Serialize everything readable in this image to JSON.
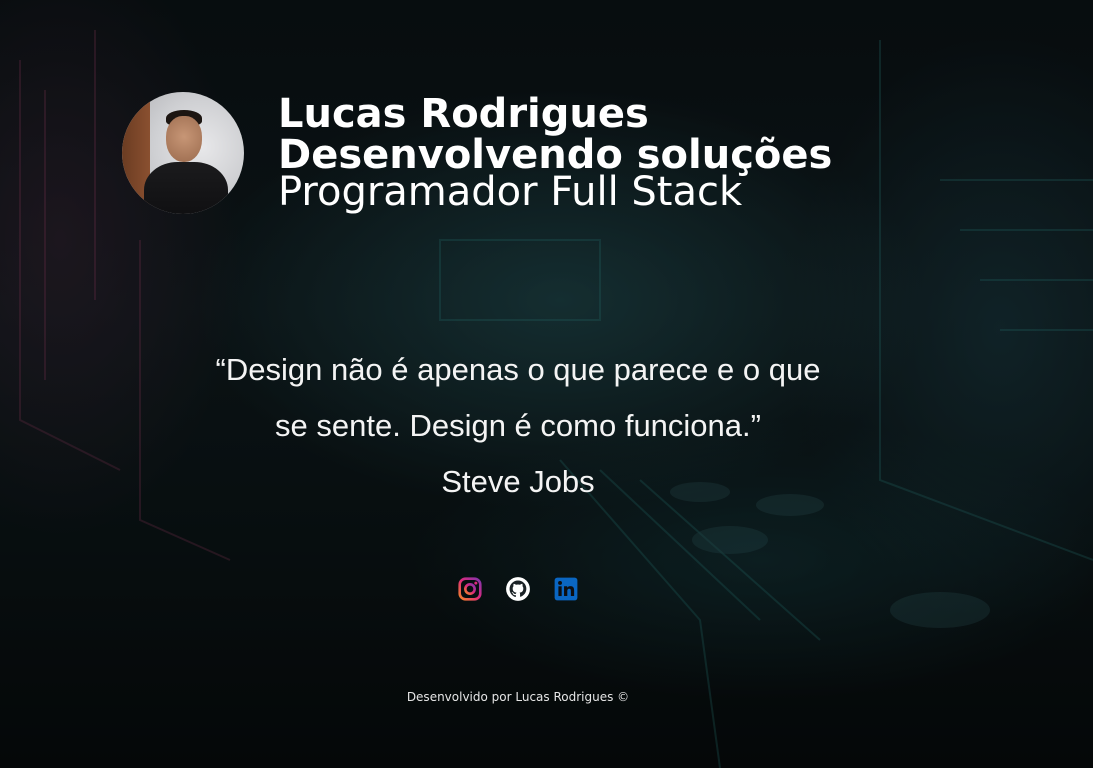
{
  "header": {
    "name": "Lucas Rodrigues",
    "tagline": "Desenvolvendo soluções",
    "role": "Programador Full Stack"
  },
  "quote": {
    "line1": "“Design não é apenas o que parece e o que",
    "line2": "se sente. Design é como funciona.”",
    "author": "Steve Jobs"
  },
  "social": [
    {
      "name": "instagram-icon",
      "color": "#e1306c"
    },
    {
      "name": "github-icon",
      "color": "#ffffff"
    },
    {
      "name": "linkedin-icon",
      "color": "#0a66c2"
    }
  ],
  "footer": {
    "text": "Desenvolvido por Lucas Rodrigues ©"
  }
}
